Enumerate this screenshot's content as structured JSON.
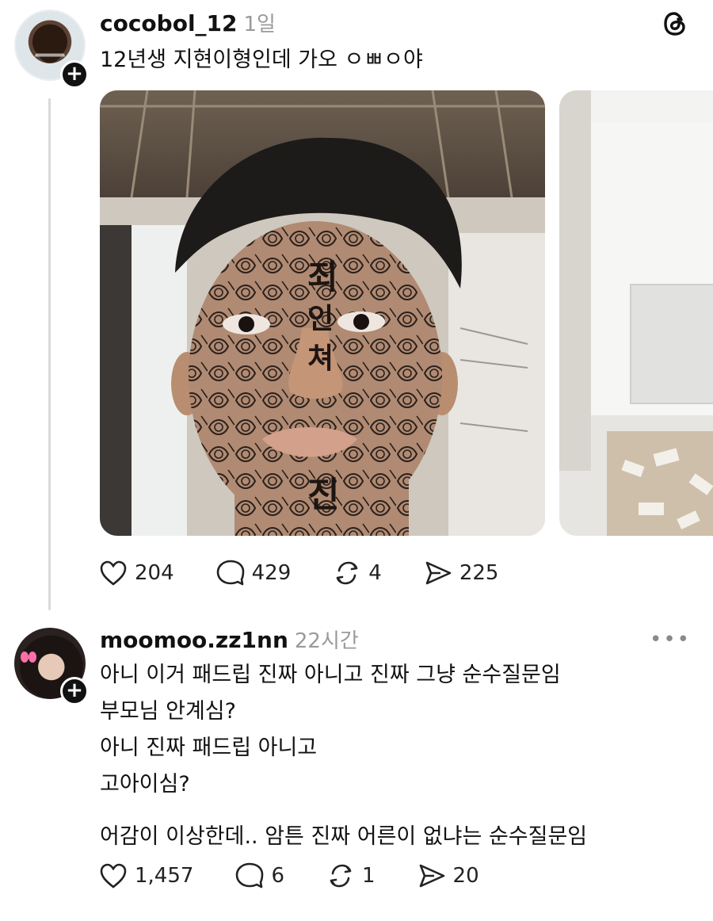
{
  "post": {
    "username": "cocobol_12",
    "timestamp": "1일",
    "text": "12년생 지현이형인데 가오 ㅇㅃㅇ야",
    "follow_icon": "+",
    "stats": {
      "likes": "204",
      "replies": "429",
      "reposts": "4",
      "shares": "225"
    }
  },
  "comment": {
    "username": "moomoo.zz1nn",
    "timestamp": "22시간",
    "follow_icon": "+",
    "more_icon": "•••",
    "lines": [
      "아니 이거 패드립 진짜 아니고 진짜 그냥 순수질문임",
      "부모님 안계심?",
      "아니 진짜 패드립 아니고",
      "고아이심?",
      "어감이 이상한데.. 암튼 진짜 어른이 없냐는 순수질문임"
    ],
    "stats": {
      "likes": "1,457",
      "replies": "6",
      "reposts": "1",
      "shares": "20"
    }
  },
  "icons": [
    "threads-logo-icon",
    "heart-icon",
    "comment-icon",
    "repost-icon",
    "share-icon",
    "more-icon"
  ]
}
